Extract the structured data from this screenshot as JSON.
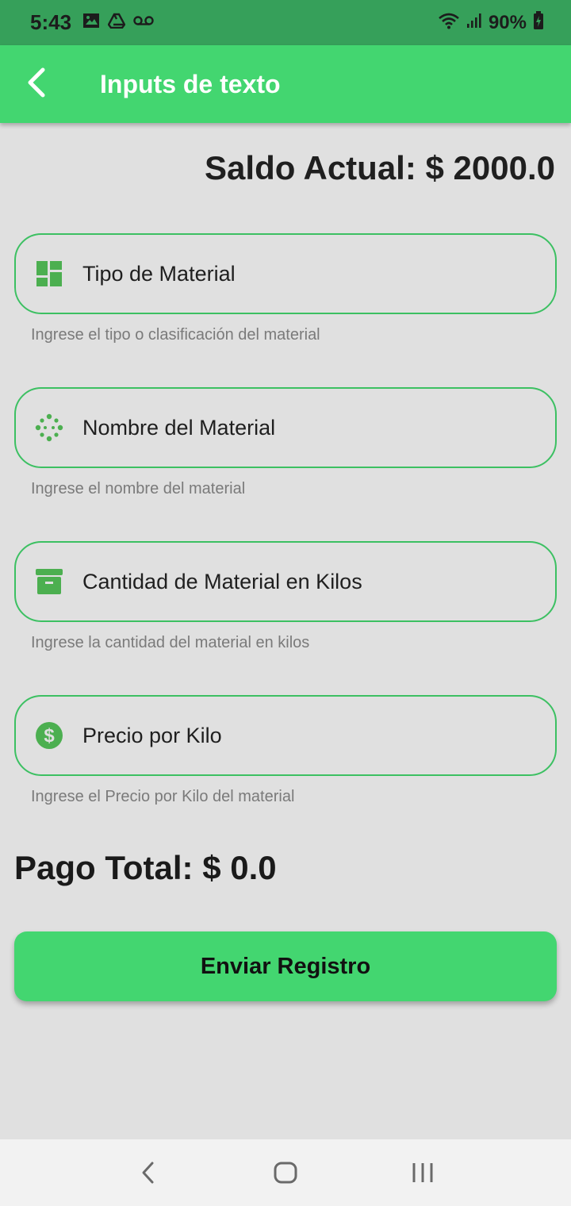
{
  "status_bar": {
    "time": "5:43",
    "battery": "90%",
    "icons": [
      "image-icon",
      "drive-icon",
      "voicemail-icon",
      "wifi-icon",
      "signal-icon",
      "battery-charging-icon"
    ]
  },
  "app_bar": {
    "title": "Inputs de texto",
    "back_icon": "arrow-back-icon"
  },
  "balance": {
    "text": "Saldo Actual: $ 2000.0"
  },
  "fields": [
    {
      "label": "Tipo de Material",
      "helper": "Ingrese el tipo o clasificación del material",
      "icon": "dashboard-icon"
    },
    {
      "label": "Nombre del Material",
      "helper": "Ingrese el nombre del material",
      "icon": "scatter-dots-icon"
    },
    {
      "label": "Cantidad de Material en Kilos",
      "helper": "Ingrese la cantidad del material en kilos",
      "icon": "archive-box-icon"
    },
    {
      "label": "Precio por Kilo",
      "helper": "Ingrese el Precio por Kilo del material",
      "icon": "dollar-circle-icon"
    }
  ],
  "total": {
    "text": "Pago Total: $ 0.0"
  },
  "submit": {
    "label": "Enviar Registro"
  },
  "colors": {
    "status_bar": "#36a05a",
    "app_bar": "#43d670",
    "field_border": "#3cc062",
    "icon_green": "#4caf50",
    "background": "#e0e0e0"
  },
  "nav_bar": {
    "icons": [
      "nav-back-icon",
      "nav-home-icon",
      "nav-recents-icon"
    ]
  }
}
